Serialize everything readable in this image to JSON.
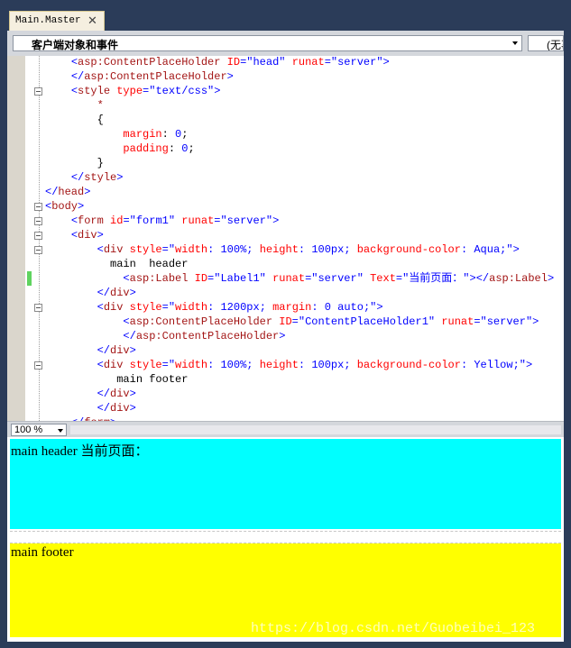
{
  "tab": {
    "title": "Main.Master",
    "close_glyph": "✕"
  },
  "navbar": {
    "object_dropdown": "客户端对象和事件",
    "event_dropdown": "(无事"
  },
  "code_lines": [
    {
      "tokens": [
        {
          "text": "    "
        },
        {
          "text": "<",
          "c": "blue"
        },
        {
          "text": "asp:ContentPlaceHolder",
          "c": "maroon"
        },
        {
          "text": " "
        },
        {
          "text": "ID",
          "c": "red"
        },
        {
          "text": "=",
          "c": "blue"
        },
        {
          "text": "\"head\"",
          "c": "blue"
        },
        {
          "text": " "
        },
        {
          "text": "runat",
          "c": "red"
        },
        {
          "text": "=",
          "c": "blue"
        },
        {
          "text": "\"server\"",
          "c": "blue"
        },
        {
          "text": ">",
          "c": "blue"
        }
      ]
    },
    {
      "tokens": [
        {
          "text": "    "
        },
        {
          "text": "</",
          "c": "blue"
        },
        {
          "text": "asp:ContentPlaceHolder",
          "c": "maroon"
        },
        {
          "text": ">",
          "c": "blue"
        }
      ]
    },
    {
      "tokens": [
        {
          "text": "    "
        },
        {
          "text": "<",
          "c": "blue"
        },
        {
          "text": "style",
          "c": "maroon"
        },
        {
          "text": " "
        },
        {
          "text": "type",
          "c": "red"
        },
        {
          "text": "=",
          "c": "blue"
        },
        {
          "text": "\"text/css\"",
          "c": "blue"
        },
        {
          "text": ">",
          "c": "blue"
        }
      ]
    },
    {
      "tokens": [
        {
          "text": "        "
        },
        {
          "text": "*",
          "c": "maroon"
        }
      ]
    },
    {
      "tokens": [
        {
          "text": "        "
        },
        {
          "text": "{",
          "c": "black"
        }
      ]
    },
    {
      "tokens": [
        {
          "text": "            "
        },
        {
          "text": "margin",
          "c": "red"
        },
        {
          "text": ": ",
          "c": "black"
        },
        {
          "text": "0",
          "c": "blue"
        },
        {
          "text": ";",
          "c": "black"
        }
      ]
    },
    {
      "tokens": [
        {
          "text": "            "
        },
        {
          "text": "padding",
          "c": "red"
        },
        {
          "text": ": ",
          "c": "black"
        },
        {
          "text": "0",
          "c": "blue"
        },
        {
          "text": ";",
          "c": "black"
        }
      ]
    },
    {
      "tokens": [
        {
          "text": "        "
        },
        {
          "text": "}",
          "c": "black"
        }
      ]
    },
    {
      "tokens": [
        {
          "text": "    "
        },
        {
          "text": "</",
          "c": "blue"
        },
        {
          "text": "style",
          "c": "maroon"
        },
        {
          "text": ">",
          "c": "blue"
        }
      ]
    },
    {
      "tokens": [
        {
          "text": "</",
          "c": "blue"
        },
        {
          "text": "head",
          "c": "maroon"
        },
        {
          "text": ">",
          "c": "blue"
        }
      ]
    },
    {
      "tokens": [
        {
          "text": "<",
          "c": "blue"
        },
        {
          "text": "body",
          "c": "maroon"
        },
        {
          "text": ">",
          "c": "blue"
        }
      ]
    },
    {
      "tokens": [
        {
          "text": "    "
        },
        {
          "text": "<",
          "c": "blue"
        },
        {
          "text": "form",
          "c": "maroon"
        },
        {
          "text": " "
        },
        {
          "text": "id",
          "c": "red"
        },
        {
          "text": "=",
          "c": "blue"
        },
        {
          "text": "\"form1\"",
          "c": "blue"
        },
        {
          "text": " "
        },
        {
          "text": "runat",
          "c": "red"
        },
        {
          "text": "=",
          "c": "blue"
        },
        {
          "text": "\"server\"",
          "c": "blue"
        },
        {
          "text": ">",
          "c": "blue"
        }
      ]
    },
    {
      "tokens": [
        {
          "text": "    "
        },
        {
          "text": "<",
          "c": "blue"
        },
        {
          "text": "div",
          "c": "maroon"
        },
        {
          "text": ">",
          "c": "blue"
        }
      ]
    },
    {
      "tokens": [
        {
          "text": "        "
        },
        {
          "text": "<",
          "c": "blue"
        },
        {
          "text": "div",
          "c": "maroon"
        },
        {
          "text": " "
        },
        {
          "text": "style",
          "c": "red"
        },
        {
          "text": "=",
          "c": "blue"
        },
        {
          "text": "\"",
          "c": "blue"
        },
        {
          "text": "width",
          "c": "red"
        },
        {
          "text": ": ",
          "c": "blue"
        },
        {
          "text": "100%",
          "c": "blue"
        },
        {
          "text": "; ",
          "c": "blue"
        },
        {
          "text": "height",
          "c": "red"
        },
        {
          "text": ": ",
          "c": "blue"
        },
        {
          "text": "100px",
          "c": "blue"
        },
        {
          "text": "; ",
          "c": "blue"
        },
        {
          "text": "background-color",
          "c": "red"
        },
        {
          "text": ": ",
          "c": "blue"
        },
        {
          "text": "Aqua",
          "c": "blue"
        },
        {
          "text": ";\"",
          "c": "blue"
        },
        {
          "text": ">",
          "c": "blue"
        }
      ]
    },
    {
      "tokens": [
        {
          "text": "          main  header",
          "c": "black"
        }
      ]
    },
    {
      "tokens": [
        {
          "text": "            "
        },
        {
          "text": "<",
          "c": "blue"
        },
        {
          "text": "asp:Label",
          "c": "maroon"
        },
        {
          "text": " "
        },
        {
          "text": "ID",
          "c": "red"
        },
        {
          "text": "=",
          "c": "blue"
        },
        {
          "text": "\"Label1\"",
          "c": "blue"
        },
        {
          "text": " "
        },
        {
          "text": "runat",
          "c": "red"
        },
        {
          "text": "=",
          "c": "blue"
        },
        {
          "text": "\"server\"",
          "c": "blue"
        },
        {
          "text": " "
        },
        {
          "text": "Text",
          "c": "red"
        },
        {
          "text": "=",
          "c": "blue"
        },
        {
          "text": "\"当前页面：\"",
          "c": "blue"
        },
        {
          "text": "></",
          "c": "blue"
        },
        {
          "text": "asp:Label",
          "c": "maroon"
        },
        {
          "text": ">",
          "c": "blue"
        }
      ]
    },
    {
      "tokens": [
        {
          "text": "        "
        },
        {
          "text": "</",
          "c": "blue"
        },
        {
          "text": "div",
          "c": "maroon"
        },
        {
          "text": ">",
          "c": "blue"
        }
      ]
    },
    {
      "tokens": [
        {
          "text": "        "
        },
        {
          "text": "<",
          "c": "blue"
        },
        {
          "text": "div",
          "c": "maroon"
        },
        {
          "text": " "
        },
        {
          "text": "style",
          "c": "red"
        },
        {
          "text": "=",
          "c": "blue"
        },
        {
          "text": "\"",
          "c": "blue"
        },
        {
          "text": "width",
          "c": "red"
        },
        {
          "text": ": ",
          "c": "blue"
        },
        {
          "text": "1200px",
          "c": "blue"
        },
        {
          "text": "; ",
          "c": "blue"
        },
        {
          "text": "margin",
          "c": "red"
        },
        {
          "text": ": ",
          "c": "blue"
        },
        {
          "text": "0 auto",
          "c": "blue"
        },
        {
          "text": ";\"",
          "c": "blue"
        },
        {
          "text": ">",
          "c": "blue"
        }
      ]
    },
    {
      "tokens": [
        {
          "text": "            "
        },
        {
          "text": "<",
          "c": "blue"
        },
        {
          "text": "asp:ContentPlaceHolder",
          "c": "maroon"
        },
        {
          "text": " "
        },
        {
          "text": "ID",
          "c": "red"
        },
        {
          "text": "=",
          "c": "blue"
        },
        {
          "text": "\"ContentPlaceHolder1\"",
          "c": "blue"
        },
        {
          "text": " "
        },
        {
          "text": "runat",
          "c": "red"
        },
        {
          "text": "=",
          "c": "blue"
        },
        {
          "text": "\"server\"",
          "c": "blue"
        },
        {
          "text": ">",
          "c": "blue"
        }
      ]
    },
    {
      "tokens": [
        {
          "text": "            "
        },
        {
          "text": "</",
          "c": "blue"
        },
        {
          "text": "asp:ContentPlaceHolder",
          "c": "maroon"
        },
        {
          "text": ">",
          "c": "blue"
        }
      ]
    },
    {
      "tokens": [
        {
          "text": "        "
        },
        {
          "text": "</",
          "c": "blue"
        },
        {
          "text": "div",
          "c": "maroon"
        },
        {
          "text": ">",
          "c": "blue"
        }
      ]
    },
    {
      "tokens": [
        {
          "text": "        "
        },
        {
          "text": "<",
          "c": "blue"
        },
        {
          "text": "div",
          "c": "maroon"
        },
        {
          "text": " "
        },
        {
          "text": "style",
          "c": "red"
        },
        {
          "text": "=",
          "c": "blue"
        },
        {
          "text": "\"",
          "c": "blue"
        },
        {
          "text": "width",
          "c": "red"
        },
        {
          "text": ": ",
          "c": "blue"
        },
        {
          "text": "100%",
          "c": "blue"
        },
        {
          "text": "; ",
          "c": "blue"
        },
        {
          "text": "height",
          "c": "red"
        },
        {
          "text": ": ",
          "c": "blue"
        },
        {
          "text": "100px",
          "c": "blue"
        },
        {
          "text": "; ",
          "c": "blue"
        },
        {
          "text": "background-color",
          "c": "red"
        },
        {
          "text": ": ",
          "c": "blue"
        },
        {
          "text": "Yellow",
          "c": "blue"
        },
        {
          "text": ";\"",
          "c": "blue"
        },
        {
          "text": ">",
          "c": "blue"
        }
      ]
    },
    {
      "tokens": [
        {
          "text": "           main footer",
          "c": "black"
        }
      ]
    },
    {
      "tokens": [
        {
          "text": "        "
        },
        {
          "text": "</",
          "c": "blue"
        },
        {
          "text": "div",
          "c": "maroon"
        },
        {
          "text": ">",
          "c": "blue"
        }
      ]
    },
    {
      "tokens": [
        {
          "text": "        "
        },
        {
          "text": "</",
          "c": "blue"
        },
        {
          "text": "div",
          "c": "maroon"
        },
        {
          "text": ">",
          "c": "blue"
        }
      ]
    },
    {
      "tokens": [
        {
          "text": "    "
        },
        {
          "text": "</",
          "c": "blue"
        },
        {
          "text": "form",
          "c": "maroon"
        },
        {
          "text": ">",
          "c": "blue"
        }
      ]
    }
  ],
  "zoom": {
    "value": "100 %"
  },
  "design_view": {
    "header_text": "main header 当前页面：",
    "footer_text": "main footer",
    "header_bg": "#00ffff",
    "footer_bg": "#ffff00"
  },
  "watermark": "https://blog.csdn.net/Guobeibei_123",
  "colors": {
    "frame": "#2b3c59",
    "keyword_blue": "#0000ff",
    "tag_maroon": "#a31515",
    "attr_red": "#ff0000",
    "change_marker": "#5fd35f"
  }
}
